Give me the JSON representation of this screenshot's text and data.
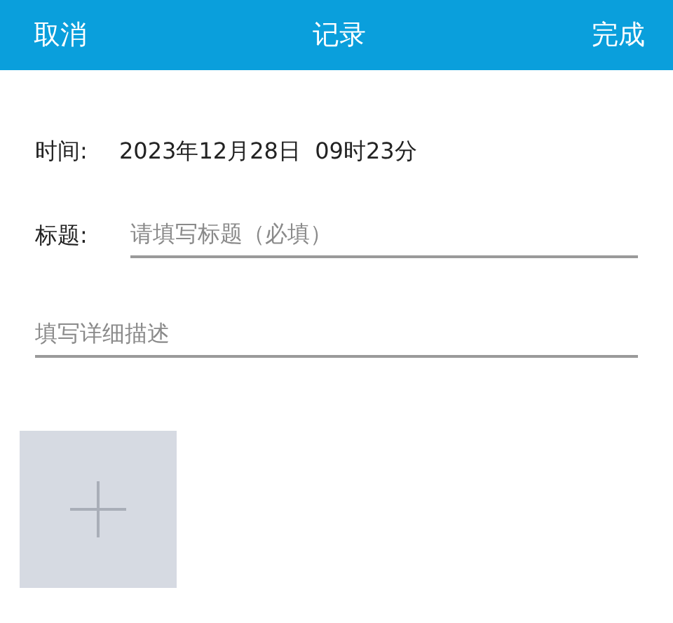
{
  "header": {
    "left_button": "取消",
    "title": "记录",
    "right_button": "完成"
  },
  "time": {
    "label": "时间:",
    "value": "2023年12月28日  09时23分"
  },
  "title_field": {
    "label": "标题:",
    "placeholder": "请填写标题（必填）"
  },
  "description_field": {
    "placeholder": "填写详细描述"
  },
  "add_photo": {
    "kind": "add"
  }
}
